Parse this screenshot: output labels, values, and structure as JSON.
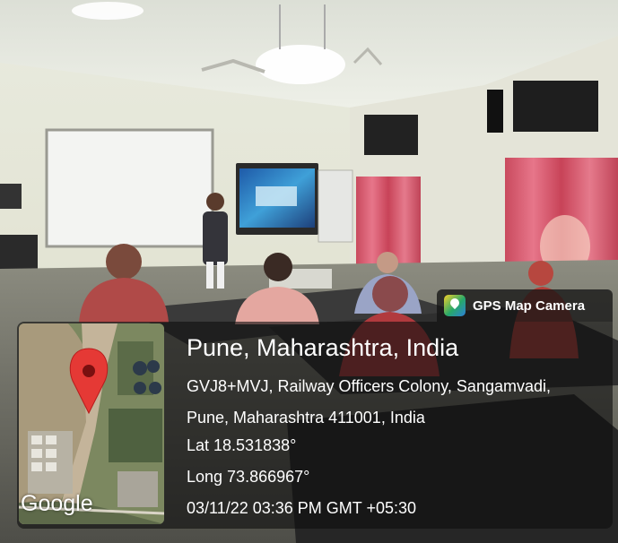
{
  "badge": {
    "label": "GPS Map Camera",
    "icon": "gps-map-camera-icon"
  },
  "location": {
    "title": "Pune, Maharashtra, India",
    "address_line1": "GVJ8+MVJ, Railway Officers Colony, Sangamvadi,",
    "address_line2": "Pune, Maharashtra 411001, India",
    "lat": "Lat 18.531838°",
    "long": "Long 73.866967°",
    "datetime": "03/11/22 03:36 PM GMT +05:30"
  },
  "map": {
    "watermark": "Google",
    "marker_color": "#e53935"
  }
}
